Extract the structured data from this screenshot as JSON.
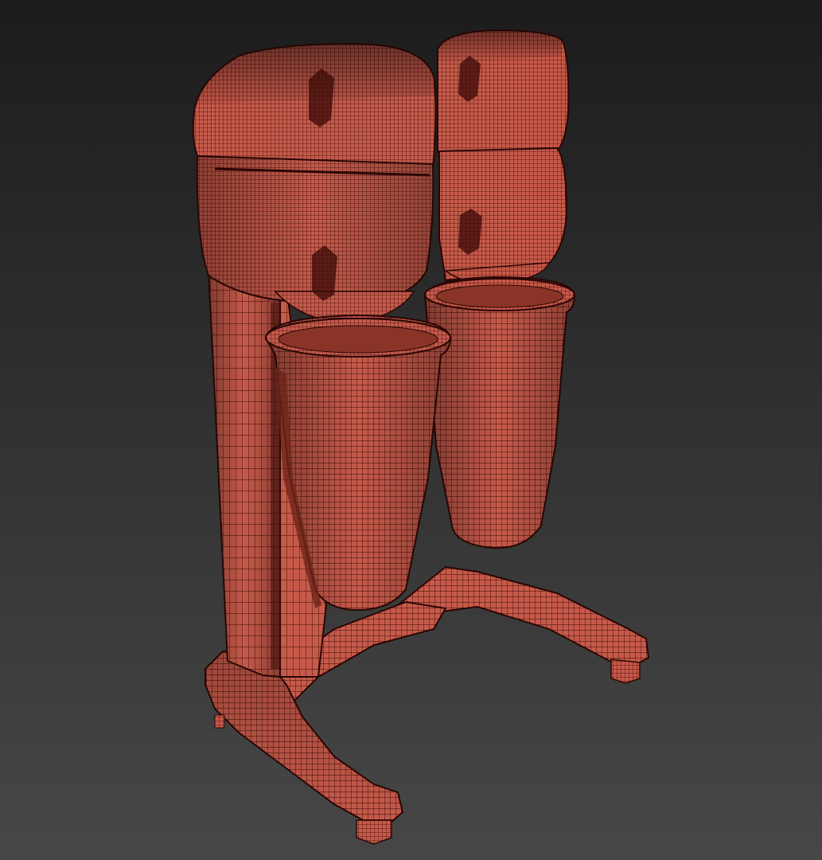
{
  "viewport": {
    "render_mode": "wireframe-on-shaded",
    "background_top": "#1c1c1c",
    "background_bottom": "#474747"
  },
  "model": {
    "subject": "double-spindle-drink-mixer",
    "shade_color": "#c65a4a",
    "wire_color": "#3a0a06",
    "shadow_color": "#8a3428"
  }
}
